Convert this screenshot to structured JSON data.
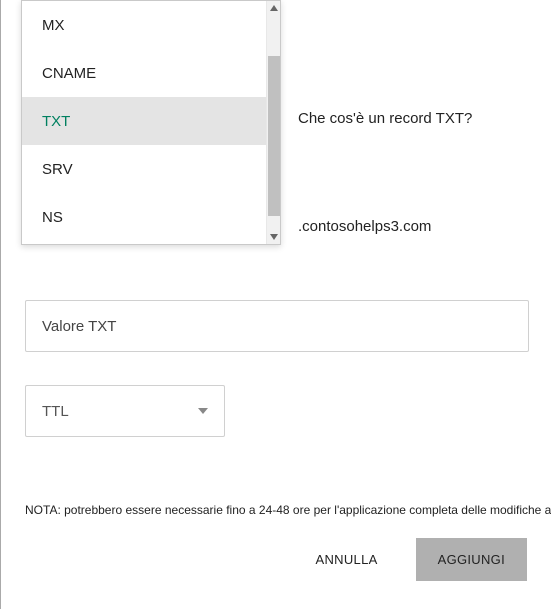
{
  "dropdown": {
    "items": [
      {
        "label": "MX"
      },
      {
        "label": "CNAME"
      },
      {
        "label": "TXT",
        "selected": true
      },
      {
        "label": "SRV"
      },
      {
        "label": "NS"
      }
    ]
  },
  "help_link": "Che cos'è un record TXT?",
  "domain_suffix": ".contosohelps3.com",
  "value_input": {
    "placeholder": "Valore TXT",
    "value": ""
  },
  "ttl": {
    "label": "TTL"
  },
  "note": "NOTA: potrebbero essere necessarie fino a 24-48 ore per l'applicazione completa delle modifiche al DNS.",
  "buttons": {
    "cancel": "ANNULLA",
    "add": "AGGIUNGI"
  }
}
